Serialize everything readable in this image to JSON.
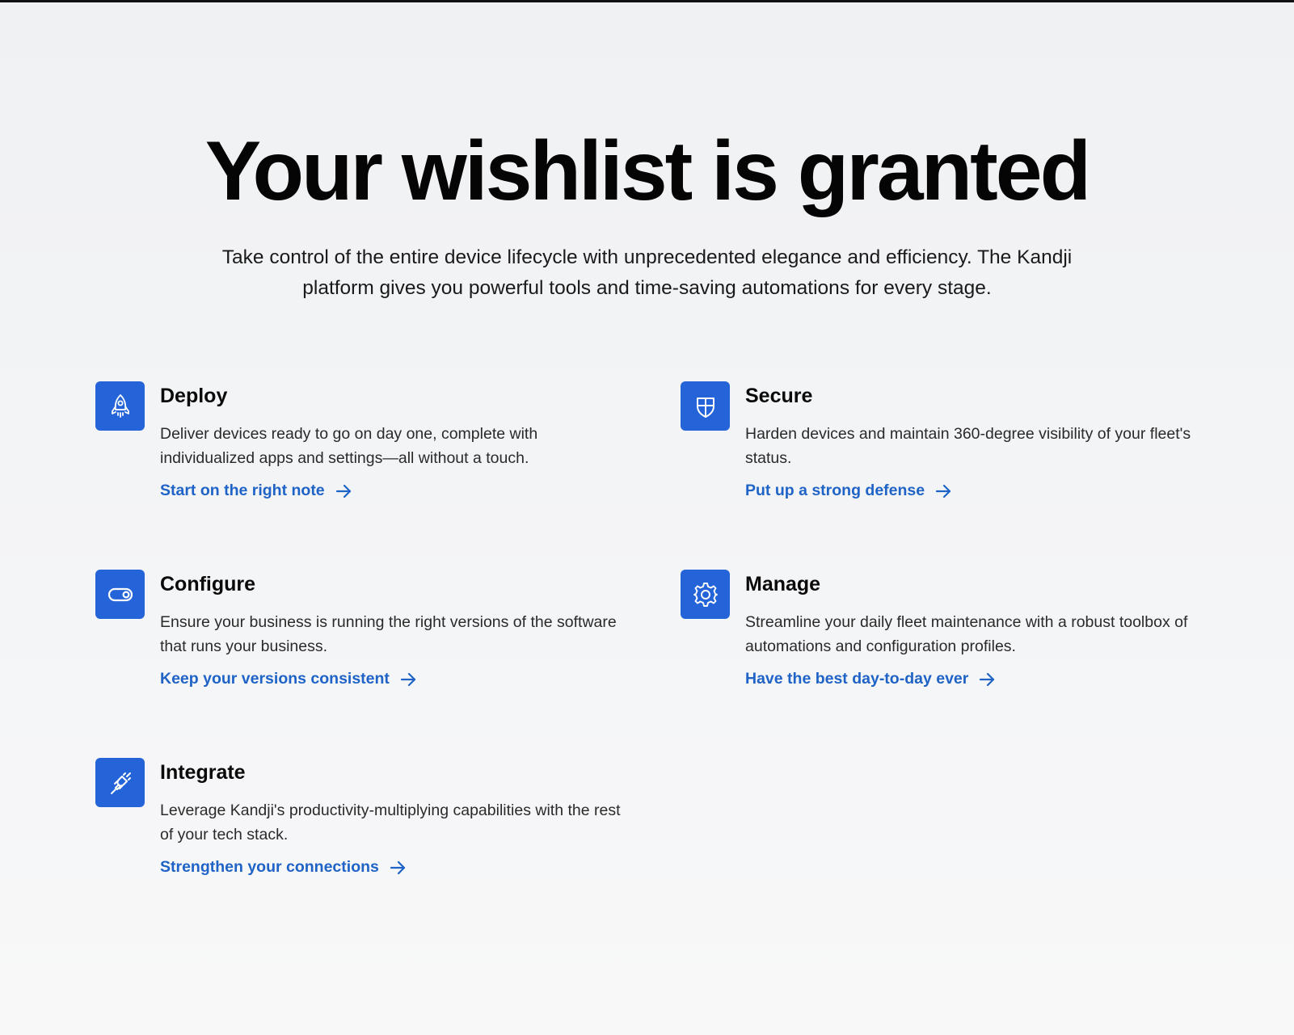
{
  "hero": {
    "title": "Your wishlist is granted",
    "subtitle": "Take control of the entire device lifecycle with unprecedented elegance and efficiency. The Kandji platform gives you powerful tools and time-saving automations for every stage."
  },
  "colors": {
    "accent": "#2464d8",
    "link": "#1f63c7"
  },
  "features": [
    {
      "icon": "rocket-icon",
      "title": "Deploy",
      "description": "Deliver devices ready to go on day one, complete with individualized apps and settings—all without a touch.",
      "link": "Start on the right note"
    },
    {
      "icon": "shield-icon",
      "title": "Secure",
      "description": "Harden devices and maintain 360-degree visibility of your fleet's status.",
      "link": "Put up a strong defense"
    },
    {
      "icon": "toggle-icon",
      "title": "Configure",
      "description": "Ensure your business is running the right versions of the software that runs your business.",
      "link": "Keep your versions consistent"
    },
    {
      "icon": "gear-icon",
      "title": "Manage",
      "description": "Streamline your daily fleet maintenance with a robust toolbox of automations and configuration profiles.",
      "link": "Have the best day-to-day ever"
    },
    {
      "icon": "plug-icon",
      "title": "Integrate",
      "description": "Leverage Kandji's productivity-multiplying capabilities with the rest of your tech stack.",
      "link": "Strengthen your connections"
    }
  ]
}
